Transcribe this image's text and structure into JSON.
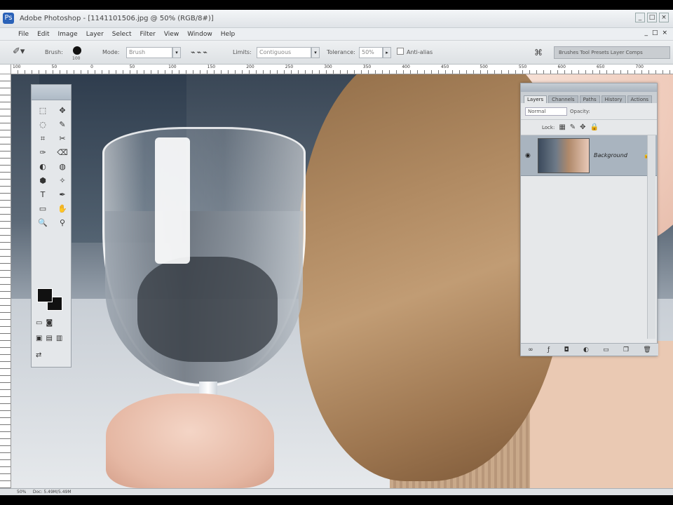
{
  "window": {
    "title": "Adobe Photoshop - [1141101506.jpg @ 50% (RGB/8#)]",
    "app_icon": "photoshop-icon",
    "controls": [
      "_",
      "□",
      "×"
    ]
  },
  "menu": {
    "items": [
      "File",
      "Edit",
      "Image",
      "Layer",
      "Select",
      "Filter",
      "View",
      "Window",
      "Help"
    ],
    "doc_controls": [
      "_",
      "□",
      "×"
    ]
  },
  "options_bar": {
    "tool_icon": "magic-eraser-icon",
    "brush_label": "Brush:",
    "brush_size": "100",
    "mode_label": "Mode:",
    "mode_value": "Brush",
    "limits_label": "Limits:",
    "limits_value": "Contiguous",
    "tolerance_label": "Tolerance:",
    "tolerance_value": "50%",
    "antialias_label": "Anti-alias",
    "well_label": "Brushes  Tool Presets  Layer Comps"
  },
  "ruler": {
    "top_numbers": [
      "100",
      "50",
      "0",
      "50",
      "100",
      "150",
      "200",
      "250",
      "300",
      "350",
      "400",
      "450",
      "500",
      "550",
      "600",
      "650",
      "700"
    ]
  },
  "tools": {
    "items": [
      "⬚",
      "✥",
      "◌",
      "✎",
      "⌗",
      "✂",
      "✑",
      "⌫",
      "◐",
      "◍",
      "⬢",
      "✧",
      "T",
      "✒",
      "▭",
      "✋",
      "🔍",
      "⚲"
    ]
  },
  "layers_panel": {
    "tabs": [
      "Layers",
      "Channels",
      "Paths",
      "History",
      "Actions"
    ],
    "blend_mode": "Normal",
    "opacity_label": "Opacity:",
    "lock_label": "Lock:",
    "layer_name": "Background",
    "footer_icons": [
      "link-icon",
      "style-icon",
      "mask-icon",
      "adjust-icon",
      "folder-icon",
      "new-layer-icon",
      "trash-icon"
    ]
  },
  "status": {
    "zoom": "50%",
    "doc_size": "Doc: 5.49M/5.49M"
  }
}
